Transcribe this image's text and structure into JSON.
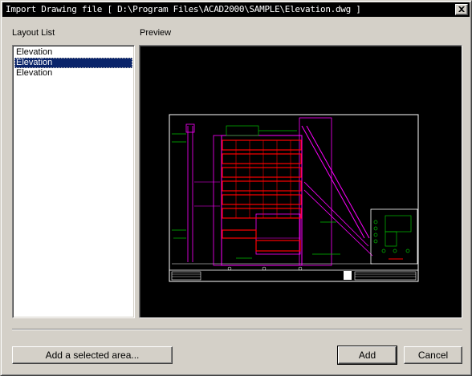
{
  "window": {
    "title": "Import Drawing file [ D:\\Program Files\\ACAD2000\\SAMPLE\\Elevation.dwg ]"
  },
  "layout_list": {
    "label": "Layout List",
    "items": [
      {
        "label": "Elevation",
        "selected": false
      },
      {
        "label": "Elevation",
        "selected": true
      },
      {
        "label": "Elevation",
        "selected": false
      }
    ]
  },
  "preview": {
    "label": "Preview",
    "background": "#000000",
    "colors": {
      "sheet": "#ffffff",
      "building": "#ff00ff",
      "floors": "#ff0000",
      "annotations": "#00c000"
    }
  },
  "buttons": {
    "add_area": "Add a selected area...",
    "add": "Add",
    "cancel": "Cancel"
  },
  "colors": {
    "face": "#d4d0c8",
    "titlebar": "#000000",
    "selection": "#0a246a"
  }
}
